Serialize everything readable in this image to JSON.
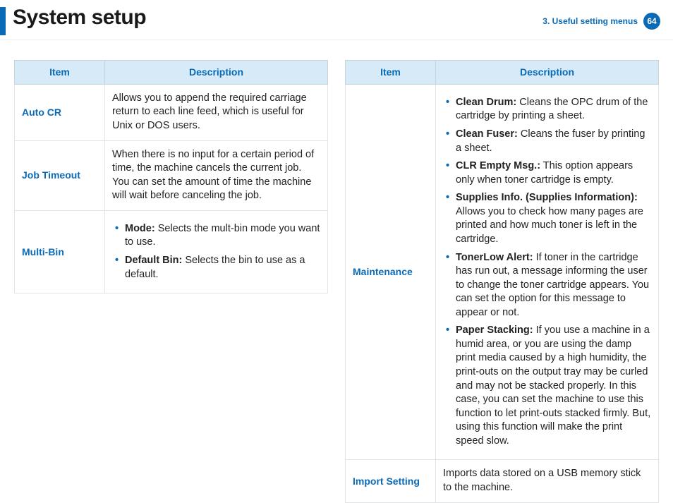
{
  "header": {
    "title": "System setup",
    "section": "3.  Useful setting menus",
    "page": "64"
  },
  "columns": {
    "item": "Item",
    "desc": "Description"
  },
  "left": [
    {
      "item": "Auto CR",
      "text": "Allows you to append the required carriage return to each line feed, which is useful for Unix or DOS users."
    },
    {
      "item": "Job Timeout",
      "text": "When there is no input for a certain period of time, the machine cancels the current job. You can set the amount of time the machine will wait before canceling the job."
    },
    {
      "item": "Multi-Bin",
      "bullets": [
        {
          "label": "Mode:",
          "text": " Selects the mult-bin mode you want to use."
        },
        {
          "label": "Default Bin:",
          "text": " Selects the bin to use as a default."
        }
      ]
    }
  ],
  "right": [
    {
      "item": "Maintenance",
      "bullets": [
        {
          "label": "Clean Drum:",
          "text": " Cleans the OPC drum of the cartridge by printing a sheet."
        },
        {
          "label": "Clean Fuser:",
          "text": " Cleans the fuser by printing a sheet."
        },
        {
          "label": "CLR Empty Msg.:",
          "text": "  This option appears only when toner cartridge is empty."
        },
        {
          "label": "Supplies Info. (Supplies Information):",
          "text": " Allows you to check how many pages are printed and how much toner is left in the cartridge."
        },
        {
          "label": "TonerLow Alert:",
          "text": " If toner in the cartridge has run out, a message informing the user to change the toner cartridge appears. You can set the option for this message to appear or not."
        },
        {
          "label": "Paper Stacking:",
          "text": " If you use a machine in a humid area, or you are using the damp print media caused by a high humidity, the print-outs on the output tray may be curled and may not be stacked properly. In this case, you can set the machine to use this function to let print-outs stacked firmly. But, using this function will make the print speed slow."
        }
      ]
    },
    {
      "item": "Import Setting",
      "text": "Imports data stored on a USB memory stick to the machine."
    }
  ]
}
